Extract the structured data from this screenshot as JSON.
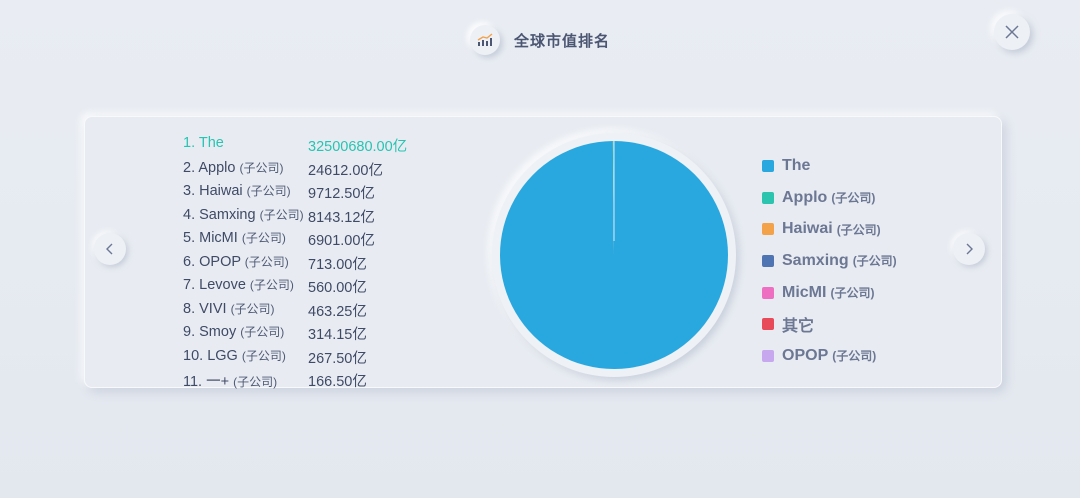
{
  "header": {
    "title": "全球市值排名",
    "title_icon": "growth-chart-icon"
  },
  "controls": {
    "close_icon": "close-icon",
    "prev_icon": "chevron-left-icon",
    "next_icon": "chevron-right-icon"
  },
  "colors": {
    "accent": "#27c4b2",
    "pie_main": "#29a8e0"
  },
  "ranking": [
    {
      "rank": "1.",
      "name": "The",
      "sub": "",
      "value": "32500680.00亿",
      "highlight": true
    },
    {
      "rank": "2.",
      "name": "Applo",
      "sub": "(子公司)",
      "value": "24612.00亿"
    },
    {
      "rank": "3.",
      "name": "Haiwai",
      "sub": "(子公司)",
      "value": "9712.50亿"
    },
    {
      "rank": "4.",
      "name": "Samxing",
      "sub": "(子公司)",
      "value": "8143.12亿"
    },
    {
      "rank": "5.",
      "name": "MicMI",
      "sub": "(子公司)",
      "value": "6901.00亿"
    },
    {
      "rank": "6.",
      "name": "OPOP",
      "sub": "(子公司)",
      "value": "713.00亿"
    },
    {
      "rank": "7.",
      "name": "Levove",
      "sub": "(子公司)",
      "value": "560.00亿"
    },
    {
      "rank": "8.",
      "name": "VIVI",
      "sub": "(子公司)",
      "value": "463.25亿"
    },
    {
      "rank": "9.",
      "name": "Smoy",
      "sub": "(子公司)",
      "value": "314.15亿"
    },
    {
      "rank": "10.",
      "name": "LGG",
      "sub": "(子公司)",
      "value": "267.50亿"
    },
    {
      "rank": "11.",
      "name": "一+",
      "sub": "(子公司)",
      "value": "166.50亿"
    }
  ],
  "legend": [
    {
      "name": "The",
      "sub": "",
      "color": "#29a8e0"
    },
    {
      "name": "Applo",
      "sub": "(子公司)",
      "color": "#2cc4ae"
    },
    {
      "name": "Haiwai",
      "sub": "(子公司)",
      "color": "#f3a24a"
    },
    {
      "name": "Samxing",
      "sub": "(子公司)",
      "color": "#4f74b3"
    },
    {
      "name": "MicMI",
      "sub": "(子公司)",
      "color": "#ee6fc1"
    },
    {
      "name": "其它",
      "sub": "",
      "color": "#e84a5a"
    },
    {
      "name": "OPOP",
      "sub": "(子公司)",
      "color": "#c7a8ef"
    }
  ],
  "chart_data": {
    "type": "pie",
    "categories": [
      "The",
      "Applo",
      "Haiwai",
      "Samxing",
      "MicMI",
      "其它",
      "OPOP"
    ],
    "values": [
      32500680.0,
      24612.0,
      9712.5,
      8143.12,
      6901.0,
      1771.4,
      713.0
    ],
    "colors": [
      "#29a8e0",
      "#2cc4ae",
      "#f3a24a",
      "#4f74b3",
      "#ee6fc1",
      "#e84a5a",
      "#c7a8ef"
    ],
    "legend_position": "right"
  }
}
